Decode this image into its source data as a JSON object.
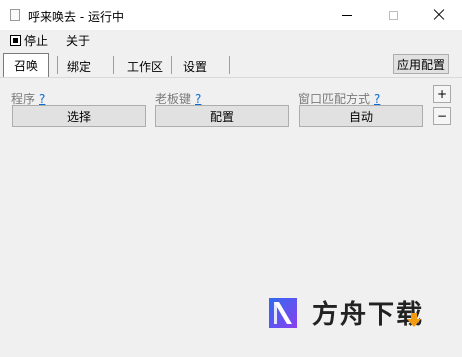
{
  "window": {
    "title": "呼来唤去 - 运行中",
    "icon": "document-icon"
  },
  "menu": {
    "stop_label": "停止",
    "about_label": "关于"
  },
  "tabs": [
    {
      "label": "召唤",
      "active": true
    },
    {
      "label": "绑定",
      "active": false
    },
    {
      "label": "工作区",
      "active": false
    },
    {
      "label": "设置",
      "active": false
    }
  ],
  "toolbar": {
    "apply_config_label": "应用配置"
  },
  "fields": {
    "program": {
      "label": "程序",
      "help": "?",
      "button": "选择"
    },
    "boss_key": {
      "label": "老板键",
      "help": "?",
      "button": "配置"
    },
    "window_match": {
      "label": "窗口匹配方式",
      "help": "?",
      "button": "自动"
    }
  },
  "side": {
    "add_label": "+",
    "remove_label": "−"
  },
  "watermark": {
    "text": "方舟下载"
  },
  "colors": {
    "help_link": "#0b6bd2",
    "disabled_label": "#7a7a7a",
    "button_bg": "#e1e1e1",
    "logo_blue": "#3f51e6",
    "logo_purple": "#8a3ff0",
    "logo_arrow": "#f39c12"
  }
}
